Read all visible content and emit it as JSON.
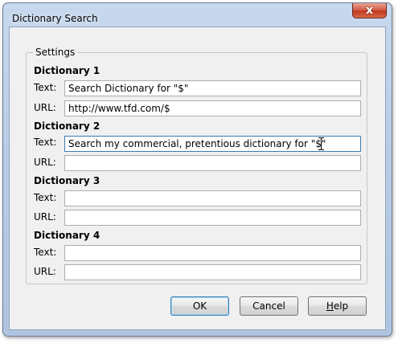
{
  "window": {
    "title": "Dictionary Search",
    "close_glyph": "x"
  },
  "settings": {
    "legend": "Settings",
    "dictionaries": [
      {
        "heading": "Dictionary 1",
        "text_label": "Text:",
        "text_value": "Search Dictionary for \"$\"",
        "url_label": "URL:",
        "url_value": "http://www.tfd.com/$"
      },
      {
        "heading": "Dictionary 2",
        "text_label": "Text:",
        "text_value": "Search my commercial, pretentious dictionary for \"$\"",
        "url_label": "URL:",
        "url_value": ""
      },
      {
        "heading": "Dictionary 3",
        "text_label": "Text:",
        "text_value": "",
        "url_label": "URL:",
        "url_value": ""
      },
      {
        "heading": "Dictionary 4",
        "text_label": "Text:",
        "text_value": "",
        "url_label": "URL:",
        "url_value": ""
      }
    ]
  },
  "buttons": {
    "ok": "OK",
    "cancel": "Cancel",
    "help_first": "H",
    "help_rest": "elp"
  },
  "colors": {
    "titlebar": "#b9cde6",
    "close_button": "#c0391f",
    "dialog_face": "#f0f0f0",
    "focus_border": "#3d7bad"
  },
  "icons": {
    "close": "close-icon",
    "text_cursor": "ibeam-cursor-icon"
  }
}
